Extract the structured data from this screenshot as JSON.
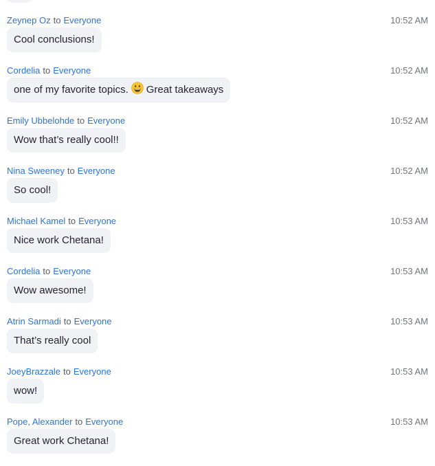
{
  "messages": [
    {
      "sender": "Zeynep Oz",
      "to": "to",
      "recipient": "Everyone",
      "time": "10:52 AM",
      "text": "Cool conclusions!"
    },
    {
      "sender": "Cordelia",
      "to": "to",
      "recipient": "Everyone",
      "time": "10:52 AM",
      "text_before": "one of my favorite topics.",
      "emoji": "grinning-face-emoji",
      "text_after": "Great takeaways"
    },
    {
      "sender": "Emily Ubbelohde",
      "to": "to",
      "recipient": "Everyone",
      "time": "10:52 AM",
      "text": "Wow that’s really cool!!"
    },
    {
      "sender": "Nina Sweeney",
      "to": "to",
      "recipient": "Everyone",
      "time": "10:52 AM",
      "text": "So cool!"
    },
    {
      "sender": "Michael Kamel",
      "to": "to",
      "recipient": "Everyone",
      "time": "10:53 AM",
      "text": "Nice work Chetana!"
    },
    {
      "sender": "Cordelia",
      "to": "to",
      "recipient": "Everyone",
      "time": "10:53 AM",
      "text": "Wow awesome!"
    },
    {
      "sender": "Atrin Sarmadi",
      "to": "to",
      "recipient": "Everyone",
      "time": "10:53 AM",
      "text": "That’s really cool"
    },
    {
      "sender": "JoeyBrazzale",
      "to": "to",
      "recipient": "Everyone",
      "time": "10:53 AM",
      "text": "wow!"
    },
    {
      "sender": "Pope, Alexander",
      "to": "to",
      "recipient": "Everyone",
      "time": "10:53 AM",
      "text": "Great work Chetana!"
    }
  ],
  "colors": {
    "name_link": "#2b74d6",
    "bubble_bg": "#f1f2f5",
    "message_text": "#232333",
    "timestamp": "#70747a"
  }
}
